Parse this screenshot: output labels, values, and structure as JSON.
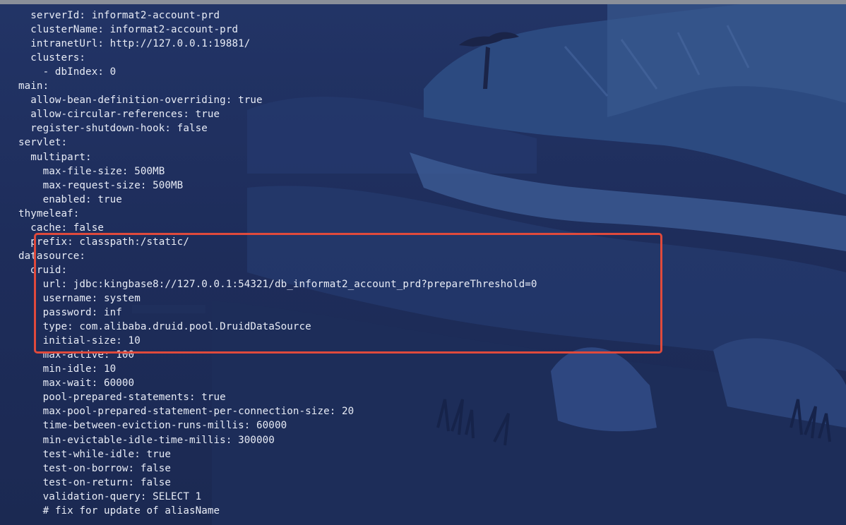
{
  "terminal": {
    "lines": [
      "  serverId: informat2-account-prd",
      "  clusterName: informat2-account-prd",
      "  intranetUrl: http://127.0.0.1:19881/",
      "  clusters:",
      "    - dbIndex: 0",
      "main:",
      "  allow-bean-definition-overriding: true",
      "  allow-circular-references: true",
      "  register-shutdown-hook: false",
      "servlet:",
      "  multipart:",
      "    max-file-size: 500MB",
      "    max-request-size: 500MB",
      "    enabled: true",
      "thymeleaf:",
      "  cache: false",
      "  prefix: classpath:/static/",
      "datasource:",
      "  druid:",
      "    url: jdbc:kingbase8://127.0.0.1:54321/db_informat2_account_prd?prepareThreshold=0",
      "    username: system",
      "    password: inf",
      "    type: com.alibaba.druid.pool.DruidDataSource",
      "    initial-size: 10",
      "    max-active: 100",
      "    min-idle: 10",
      "    max-wait: 60000",
      "    pool-prepared-statements: true",
      "    max-pool-prepared-statement-per-connection-size: 20",
      "    time-between-eviction-runs-millis: 60000",
      "    min-evictable-idle-time-millis: 300000",
      "    test-while-idle: true",
      "    test-on-borrow: false",
      "    test-on-return: false",
      "    validation-query: SELECT 1",
      "    # fix for update of aliasName"
    ]
  },
  "colors": {
    "text": "#e8ecf6",
    "highlight_border": "#e04a3c",
    "background": "#1e2d5b"
  }
}
